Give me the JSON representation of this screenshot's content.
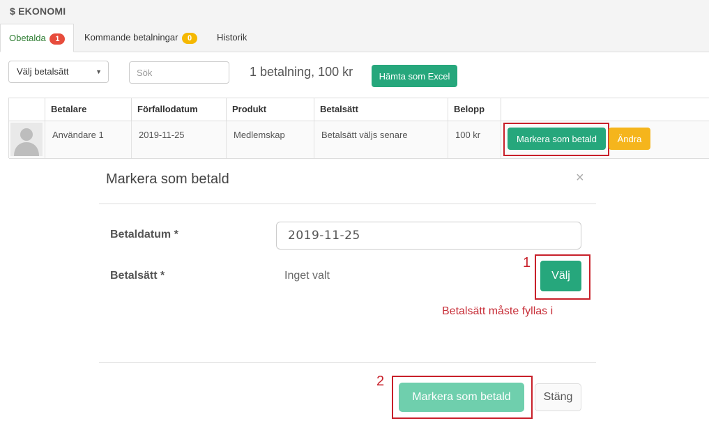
{
  "header": {
    "title": "$ EKONOMI"
  },
  "tabs": [
    {
      "label": "Obetalda",
      "badge": "1"
    },
    {
      "label": "Kommande betalningar",
      "badge": "0"
    },
    {
      "label": "Historik"
    }
  ],
  "filters": {
    "method_select": "Välj betalsätt",
    "search_placeholder": "Sök",
    "summary": "1 betalning, 100 kr",
    "excel_button": "Hämta som Excel"
  },
  "table": {
    "columns": [
      "Betalare",
      "Förfallodatum",
      "Produkt",
      "Betalsätt",
      "Belopp"
    ],
    "rows": [
      {
        "payer": "Användare 1",
        "due_date": "2019-11-25",
        "product": "Medlemskap",
        "method": "Betalsätt väljs senare",
        "amount": "100 kr"
      }
    ],
    "mark_button": "Markera som betald",
    "change_button": "Ändra"
  },
  "modal": {
    "title": "Markera som betald",
    "close_icon": "×",
    "paid_date_label": "Betaldatum *",
    "paid_date_value": "2019-11-25",
    "method_label": "Betalsätt *",
    "method_value": "Inget valt",
    "choose_button": "Välj",
    "error": "Betalsätt måste fyllas i",
    "submit_button": "Markera som betald",
    "close_button": "Stäng"
  },
  "annotations": {
    "step1": "1",
    "step2": "2"
  },
  "colors": {
    "accent_green": "#26a77c",
    "warning_yellow": "#f5b51c",
    "highlight_red": "#c8202a"
  }
}
